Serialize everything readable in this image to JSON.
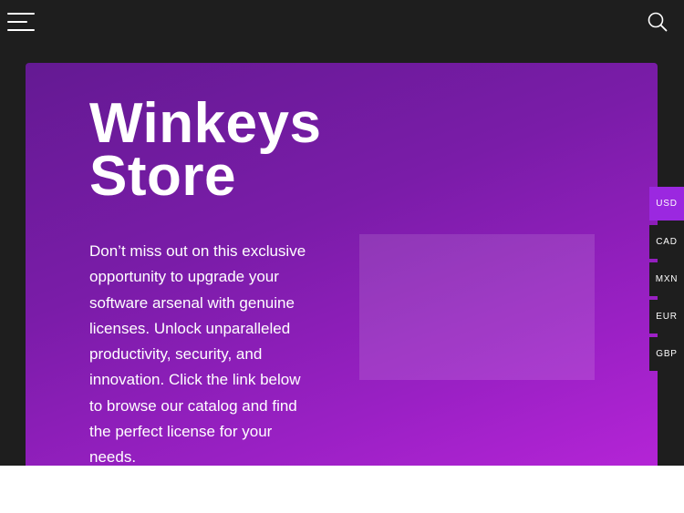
{
  "header": {
    "menu_icon": "hamburger-menu-icon",
    "search_icon": "search-icon"
  },
  "hero": {
    "title_line1": "Winkeys",
    "title_line2": "Store",
    "description": "Don’t miss out on this exclusive opportunity to upgrade your software arsenal with genuine licenses. Unlock unparalleled productivity, security, and innovation. Click the link below to browse our catalog and find the perfect license for your needs.",
    "gradient_start": "#641a93",
    "gradient_end": "#b424d6"
  },
  "currency_switcher": {
    "selected": "USD",
    "active_color": "#9b28e0",
    "options": [
      "USD",
      "CAD",
      "MXN",
      "EUR",
      "GBP"
    ]
  },
  "colors": {
    "background": "#1e1e1e",
    "text": "#ffffff"
  }
}
